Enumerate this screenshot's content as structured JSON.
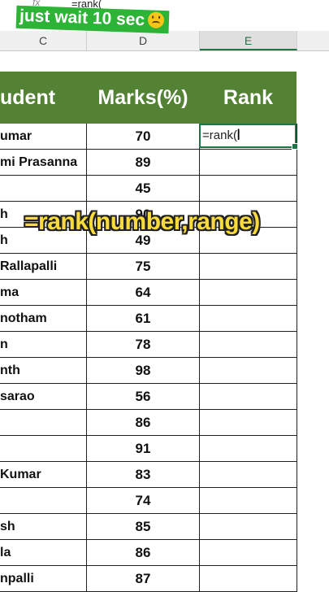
{
  "formula_bar": {
    "fx_label": "fx",
    "formula": "=rank("
  },
  "caption": {
    "text": "just wait 10 sec"
  },
  "column_headers": [
    "C",
    "D",
    "E"
  ],
  "table": {
    "headers": {
      "student": "udent",
      "marks": "Marks(%)",
      "rank": "Rank"
    },
    "rows": [
      {
        "name": "umar",
        "mark": "70",
        "rank": ""
      },
      {
        "name": "mi Prasanna",
        "mark": "89",
        "rank": ""
      },
      {
        "name": "",
        "mark": "45",
        "rank": ""
      },
      {
        "name": "h",
        "mark": "90",
        "rank": ""
      },
      {
        "name": "h",
        "mark": "49",
        "rank": ""
      },
      {
        "name": "Rallapalli",
        "mark": "75",
        "rank": ""
      },
      {
        "name": "ma",
        "mark": "64",
        "rank": ""
      },
      {
        "name": "notham",
        "mark": "61",
        "rank": ""
      },
      {
        "name": "n",
        "mark": "78",
        "rank": ""
      },
      {
        "name": "nth",
        "mark": "98",
        "rank": ""
      },
      {
        "name": "sarao",
        "mark": "56",
        "rank": ""
      },
      {
        "name": "",
        "mark": "86",
        "rank": ""
      },
      {
        "name": "",
        "mark": "91",
        "rank": ""
      },
      {
        "name": "Kumar",
        "mark": "83",
        "rank": ""
      },
      {
        "name": "",
        "mark": "74",
        "rank": ""
      },
      {
        "name": "sh",
        "mark": "85",
        "rank": ""
      },
      {
        "name": "la",
        "mark": "86",
        "rank": ""
      },
      {
        "name": "npalli",
        "mark": "87",
        "rank": ""
      }
    ]
  },
  "active_cell": {
    "text": "=rank("
  },
  "overlay": {
    "text": "=rank(number,range)"
  },
  "colors": {
    "header_green": "#548235",
    "caption_green": "#2db336",
    "overlay_yellow": "#f9dc3c",
    "selection": "#217346"
  }
}
